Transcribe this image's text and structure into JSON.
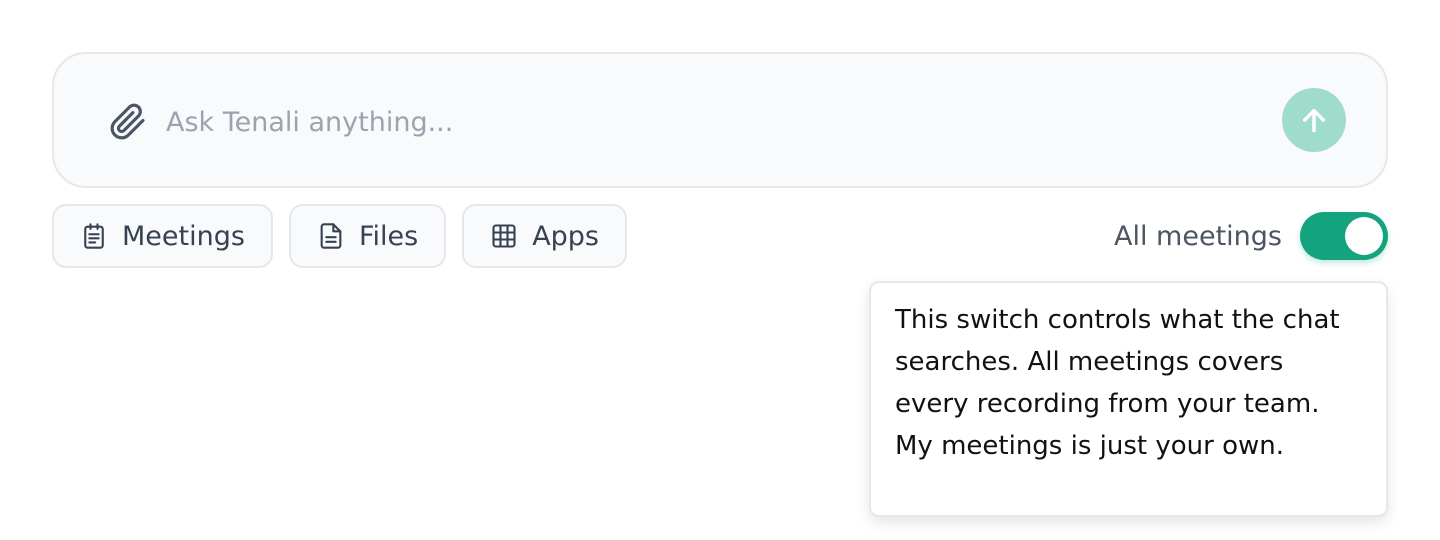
{
  "chat": {
    "placeholder": "Ask Tenali anything...",
    "value": "",
    "attach_icon": "paperclip-icon",
    "send_icon": "arrow-up-icon"
  },
  "chips": [
    {
      "label": "Meetings",
      "icon": "clipboard-icon"
    },
    {
      "label": "Files",
      "icon": "document-icon"
    },
    {
      "label": "Apps",
      "icon": "grid-icon"
    }
  ],
  "scope_toggle": {
    "label": "All meetings",
    "on": true
  },
  "tooltip": {
    "text": "This switch controls what the chat searches. All meetings covers every recording from your team. My meetings is just your own."
  },
  "colors": {
    "accent": "#14a37f",
    "send_button": "#9fdccb",
    "input_bg": "#f9fafc",
    "border": "#e5e7eb"
  }
}
